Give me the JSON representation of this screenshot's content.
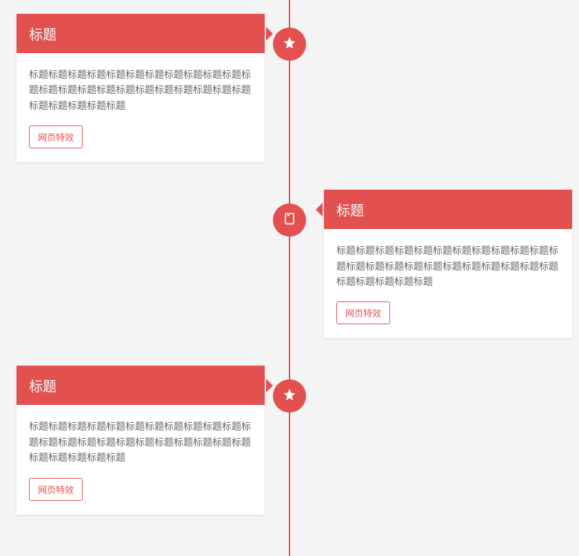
{
  "colors": {
    "accent": "#e25050"
  },
  "timeline": [
    {
      "icon": "star",
      "side": "left",
      "title": "标题",
      "body": "标题标题标题标题标题标题标题标题标题标题标题标题标题标题标题标题标题标题标题标题标题标题标题标题标题标题标题标题",
      "tag": "网页特效"
    },
    {
      "icon": "book",
      "side": "right",
      "title": "标题",
      "body": "标题标题标题标题标题标题标题标题标题标题标题标题标题标题标题标题标题标题标题标题标题标题标题标题标题标题标题标题",
      "tag": "网页特效"
    },
    {
      "icon": "star",
      "side": "left",
      "title": "标题",
      "body": "标题标题标题标题标题标题标题标题标题标题标题标题标题标题标题标题标题标题标题标题标题标题标题标题标题标题标题标题",
      "tag": "网页特效"
    }
  ]
}
